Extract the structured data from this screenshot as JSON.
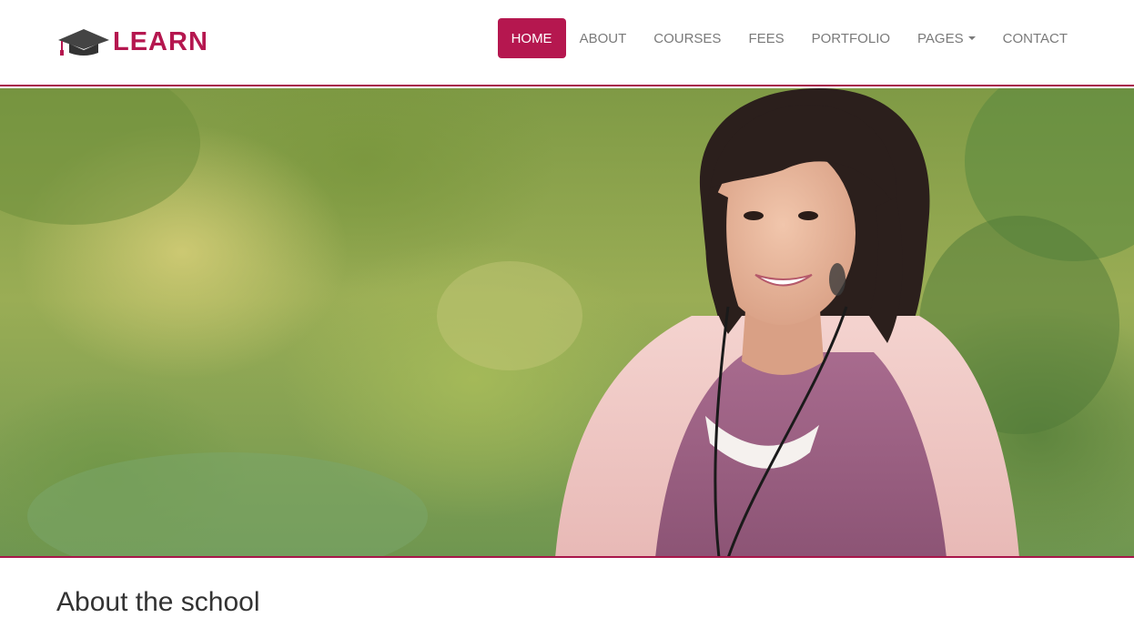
{
  "brand": {
    "name": "LEARN",
    "accent_color": "#b5174f",
    "logo_icon": "graduation-cap-icon"
  },
  "nav": {
    "items": [
      {
        "label": "HOME",
        "active": true
      },
      {
        "label": "ABOUT",
        "active": false
      },
      {
        "label": "COURSES",
        "active": false
      },
      {
        "label": "FEES",
        "active": false
      },
      {
        "label": "PORTFOLIO",
        "active": false
      },
      {
        "label": "PAGES",
        "active": false,
        "dropdown": true
      },
      {
        "label": "CONTACT",
        "active": false
      }
    ]
  },
  "hero": {
    "image": "smiling-student-photo"
  },
  "main": {
    "section_title": "About the school"
  }
}
